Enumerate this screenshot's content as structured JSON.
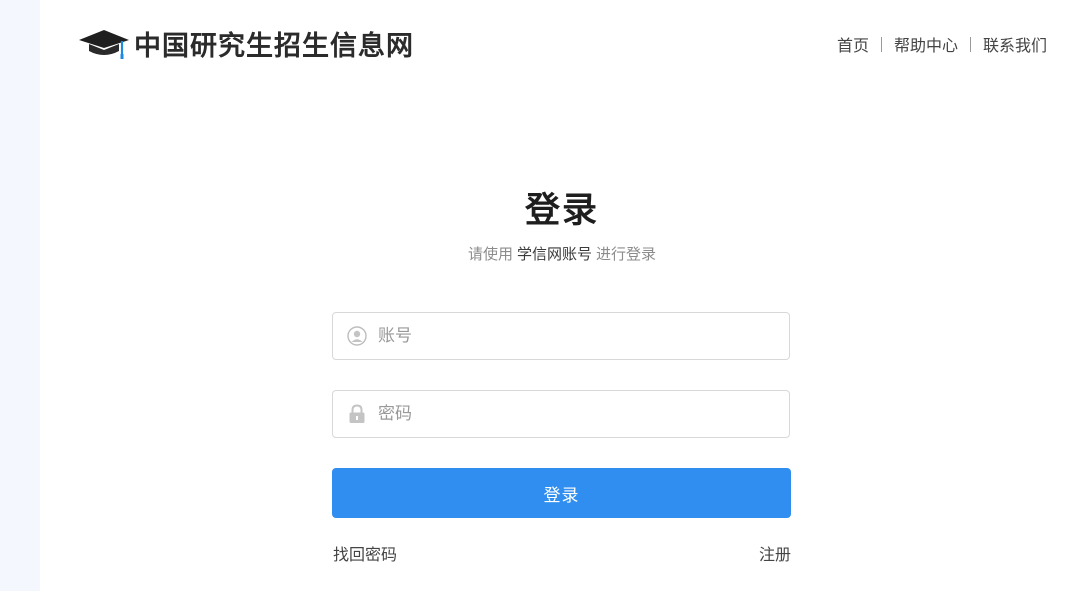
{
  "header": {
    "logo_icon": "graduation-cap-icon",
    "site_name": "中国研究生招生信息网",
    "nav": [
      {
        "label": "首页"
      },
      {
        "label": "帮助中心"
      },
      {
        "label": "联系我们"
      }
    ]
  },
  "login": {
    "title": "登录",
    "subtitle_prefix": "请使用",
    "subtitle_highlight": "学信网账号",
    "subtitle_suffix": "进行登录",
    "account": {
      "placeholder": "账号",
      "value": "",
      "icon": "user-icon"
    },
    "password": {
      "placeholder": "密码",
      "value": "",
      "icon": "lock-icon"
    },
    "submit_label": "登录",
    "forgot_label": "找回密码",
    "register_label": "注册"
  },
  "colors": {
    "primary": "#2f8ef0",
    "side_strip": "#f4f7fd",
    "logo_accent": "#1e88e5"
  }
}
